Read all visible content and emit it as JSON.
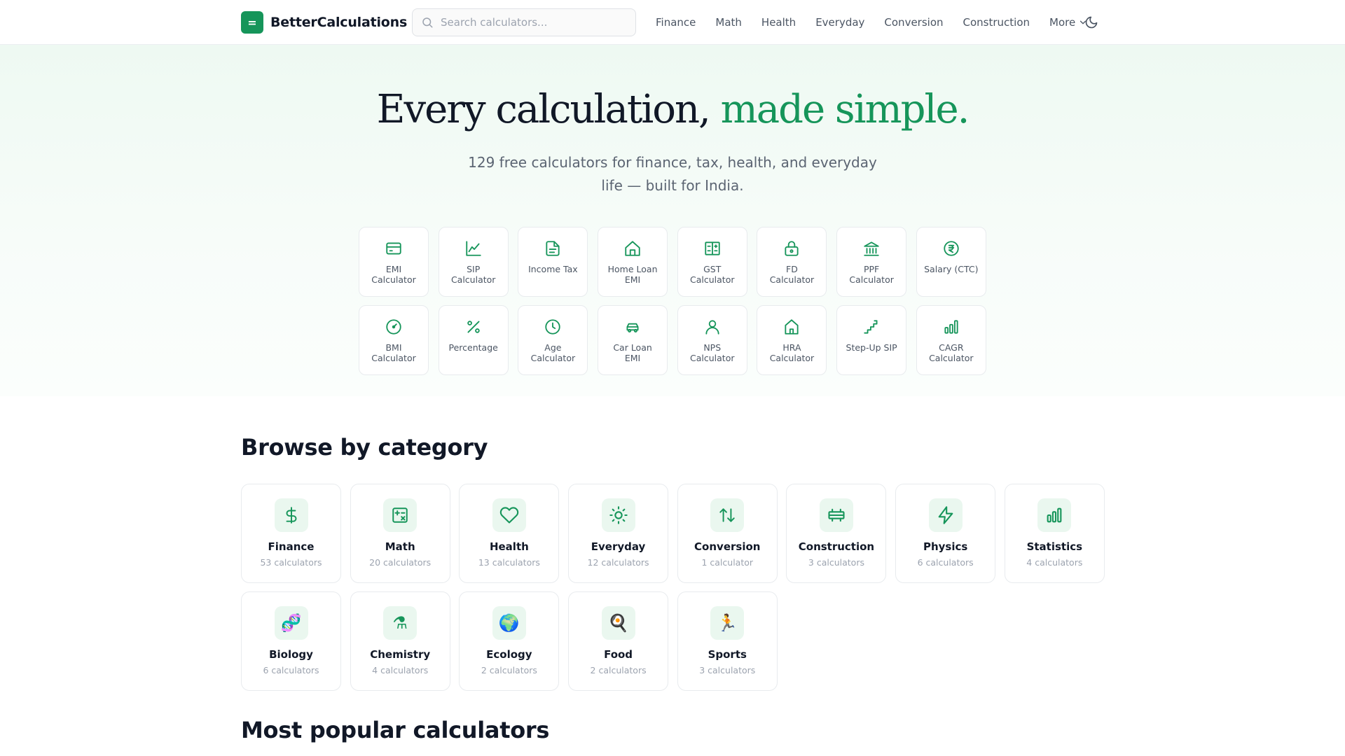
{
  "header": {
    "logo_glyph": "=",
    "brand": "BetterCalculations",
    "search_placeholder": "Search calculators...",
    "nav": [
      "Finance",
      "Math",
      "Health",
      "Everyday",
      "Conversion",
      "Construction"
    ],
    "more_label": "More",
    "theme_icon": "moon-icon"
  },
  "hero": {
    "title_main": "Every calculation,",
    "title_accent": "made simple.",
    "subtitle": "129 free calculators for finance, tax, health, and everyday life — built for India."
  },
  "quick_links": [
    {
      "label": "EMI Calculator",
      "icon": "credit-card-icon"
    },
    {
      "label": "SIP Calculator",
      "icon": "line-chart-icon"
    },
    {
      "label": "Income Tax",
      "icon": "document-icon"
    },
    {
      "label": "Home Loan EMI",
      "icon": "home-icon"
    },
    {
      "label": "GST Calculator",
      "icon": "gst-icon"
    },
    {
      "label": "FD Calculator",
      "icon": "lock-icon"
    },
    {
      "label": "PPF Calculator",
      "icon": "bank-icon"
    },
    {
      "label": "Salary (CTC)",
      "icon": "rupee-circle-icon"
    },
    {
      "label": "BMI Calculator",
      "icon": "gauge-icon"
    },
    {
      "label": "Percentage",
      "icon": "percent-icon"
    },
    {
      "label": "Age Calculator",
      "icon": "clock-icon"
    },
    {
      "label": "Car Loan EMI",
      "icon": "car-icon"
    },
    {
      "label": "NPS Calculator",
      "icon": "user-icon"
    },
    {
      "label": "HRA Calculator",
      "icon": "house-icon"
    },
    {
      "label": "Step-Up SIP",
      "icon": "stairs-icon"
    },
    {
      "label": "CAGR Calculator",
      "icon": "bar-chart-icon"
    }
  ],
  "categories_title": "Browse by category",
  "categories": [
    {
      "name": "Finance",
      "count": "53 calculators",
      "icon": "dollar-icon"
    },
    {
      "name": "Math",
      "count": "20 calculators",
      "icon": "calculator-icon"
    },
    {
      "name": "Health",
      "count": "13 calculators",
      "icon": "heart-icon"
    },
    {
      "name": "Everyday",
      "count": "12 calculators",
      "icon": "sun-icon"
    },
    {
      "name": "Conversion",
      "count": "1 calculator",
      "icon": "arrows-up-down-icon"
    },
    {
      "name": "Construction",
      "count": "3 calculators",
      "icon": "construction-icon"
    },
    {
      "name": "Physics",
      "count": "6 calculators",
      "icon": "lightning-icon"
    },
    {
      "name": "Statistics",
      "count": "4 calculators",
      "icon": "bar-chart-icon"
    },
    {
      "name": "Biology",
      "count": "6 calculators",
      "icon": "dna-icon"
    },
    {
      "name": "Chemistry",
      "count": "4 calculators",
      "icon": "flask-icon"
    },
    {
      "name": "Ecology",
      "count": "2 calculators",
      "icon": "globe-icon"
    },
    {
      "name": "Food",
      "count": "2 calculators",
      "icon": "frying-pan-icon"
    },
    {
      "name": "Sports",
      "count": "3 calculators",
      "icon": "runner-icon"
    }
  ],
  "popular_title": "Most popular calculators",
  "colors": {
    "accent": "#16955a",
    "accent_bg": "#eaf7ef",
    "text": "#111827",
    "muted": "#9ca3af"
  }
}
